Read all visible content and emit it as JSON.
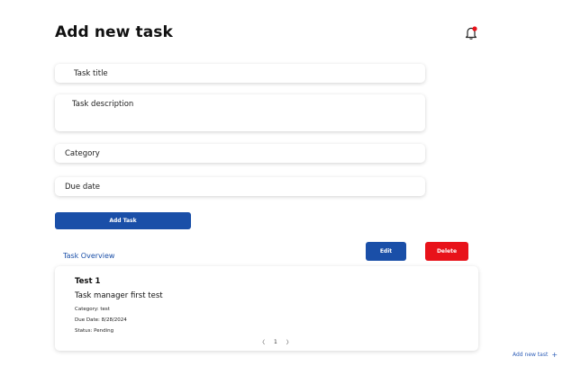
{
  "header": {
    "title": "Add new task",
    "notification_icon": "bell-icon",
    "notification_dot_color": "#e8121a"
  },
  "form": {
    "title_placeholder": "Task title",
    "description_placeholder": "Task description",
    "category_placeholder": "Category",
    "due_date_placeholder": "Due date",
    "submit_label": "Add Task"
  },
  "overview": {
    "title": "Task Overview",
    "edit_label": "Edit",
    "delete_label": "Delete"
  },
  "task": {
    "name": "Test 1",
    "description": "Task manager first test",
    "category": "Category: test",
    "due_date": "Due Date: 8/28/2024",
    "status": "Status: Pending"
  },
  "pagination": {
    "prev": "〈",
    "page": "1",
    "next": "〉"
  },
  "footer": {
    "add_link_label": "Add new tast",
    "add_link_icon": "+"
  },
  "colors": {
    "primary": "#1a4fa8",
    "danger": "#e8121a"
  }
}
